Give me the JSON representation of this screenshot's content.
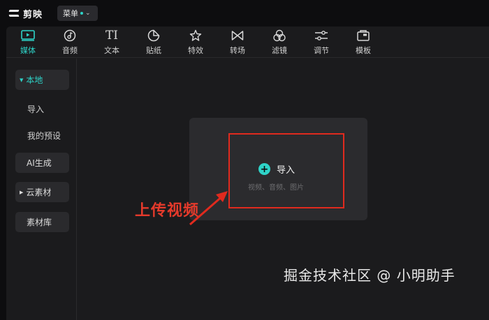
{
  "app": {
    "logo_text": "剪映",
    "menu_label": "菜单"
  },
  "toolbar": {
    "items": [
      {
        "label": "媒体",
        "icon": "media-icon",
        "active": true
      },
      {
        "label": "音频",
        "icon": "audio-icon"
      },
      {
        "label": "文本",
        "icon": "text-icon",
        "glyph": "TI"
      },
      {
        "label": "贴纸",
        "icon": "sticker-icon"
      },
      {
        "label": "特效",
        "icon": "effects-icon"
      },
      {
        "label": "转场",
        "icon": "transition-icon"
      },
      {
        "label": "滤镜",
        "icon": "filter-icon"
      },
      {
        "label": "调节",
        "icon": "adjust-icon"
      },
      {
        "label": "模板",
        "icon": "template-icon"
      }
    ]
  },
  "sidebar": {
    "local": "本地",
    "import": "导入",
    "presets": "我的预设",
    "ai": "AI生成",
    "cloud": "云素材",
    "library": "素材库"
  },
  "main": {
    "import_label": "导入",
    "import_hint": "视频、音频、图片"
  },
  "annotation": {
    "text": "上传视频",
    "color": "#e53a2b"
  },
  "watermark": "掘金技术社区 @ 小明助手",
  "colors": {
    "accent": "#2ed3c8",
    "highlight": "#e02a1e"
  }
}
